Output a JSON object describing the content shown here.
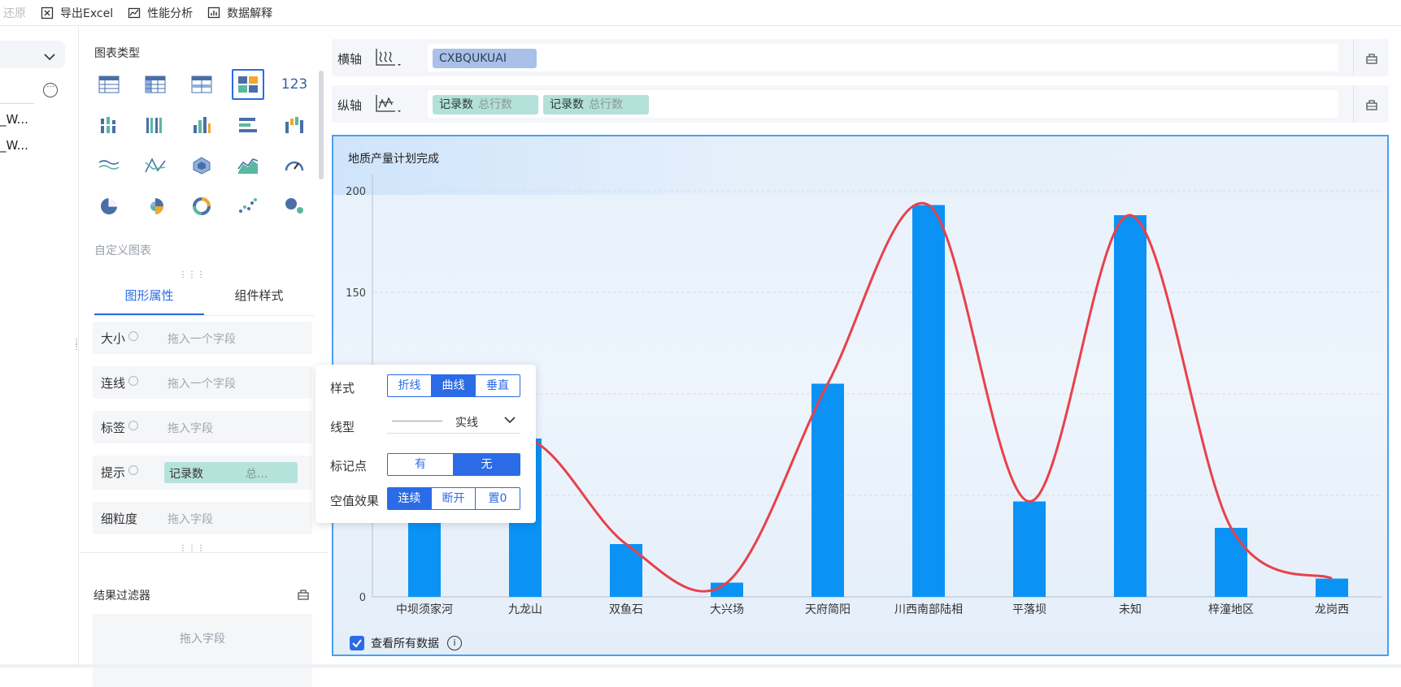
{
  "toolbar": {
    "restore_label": "还原",
    "export_label": "导出Excel",
    "perf_label": "性能分析",
    "explain_label": "数据解释"
  },
  "left_panel": {
    "items": [
      "_W...",
      "_W..."
    ]
  },
  "chart_types": {
    "title": "图表类型",
    "icons": [
      "table-icon",
      "cross-table-icon",
      "detail-table-icon",
      "card-layout-icon",
      "number-card-icon",
      "stacked-bar-icon",
      "grouped-bar-icon",
      "column-chart-icon",
      "horizontal-bar-icon",
      "waterfall-icon",
      "line-chart-icon",
      "multi-line-icon",
      "radar-icon",
      "area-chart-icon",
      "gauge-icon",
      "pie-chart-icon",
      "rose-chart-icon",
      "donut-chart-icon",
      "scatter-icon",
      "bubble-icon"
    ],
    "number_card_text": "123",
    "custom_label": "自定义图表"
  },
  "props_tabs": {
    "graph_props": "图形属性",
    "component_style": "组件样式"
  },
  "props": {
    "size_label": "大小",
    "size_ph": "拖入一个字段",
    "connect_label": "连线",
    "connect_ph": "拖入一个字段",
    "tag_label": "标签",
    "tag_ph": "拖入字段",
    "tip_label": "提示",
    "tip_chip": "记录数",
    "tip_chip_sub": "总...",
    "granularity_label": "细粒度",
    "granularity_ph": "拖入字段"
  },
  "filter": {
    "title": "结果过滤器",
    "placeholder": "拖入字段"
  },
  "axes": {
    "x_label": "横轴",
    "x_chip": "CXBQUKUAI",
    "y_label": "纵轴",
    "y_chips": [
      {
        "name": "记录数",
        "sub": "总行数"
      },
      {
        "name": "记录数",
        "sub": "总行数"
      }
    ]
  },
  "popup": {
    "style_label": "样式",
    "style_options": [
      "折线",
      "曲线",
      "垂直"
    ],
    "style_selected": "曲线",
    "linetype_label": "线型",
    "linetype_value": "实线",
    "marker_label": "标记点",
    "marker_options": [
      "有",
      "无"
    ],
    "marker_selected": "无",
    "null_label": "空值效果",
    "null_options": [
      "连续",
      "断开",
      "置0"
    ],
    "null_selected": "连续"
  },
  "chart_footer": {
    "view_all_label": "查看所有数据"
  },
  "chart_data": {
    "type": "bar",
    "title": "地质产量计划完成",
    "categories": [
      "中坝须家河",
      "九龙山",
      "双鱼石",
      "大兴场",
      "天府简阳",
      "川西南部陆相",
      "平落坝",
      "未知",
      "梓潼地区",
      "龙岗西"
    ],
    "series": [
      {
        "type": "bar",
        "values": [
          42,
          78,
          26,
          7,
          105,
          193,
          47,
          188,
          34,
          9
        ],
        "color": "#0a93f5"
      },
      {
        "type": "line",
        "style": "curve",
        "values": [
          42,
          78,
          26,
          7,
          105,
          193,
          47,
          188,
          34,
          9
        ],
        "color": "#e8414a"
      }
    ],
    "yticks": [
      0,
      150,
      200
    ],
    "ylim": [
      0,
      200
    ],
    "grid": true
  }
}
